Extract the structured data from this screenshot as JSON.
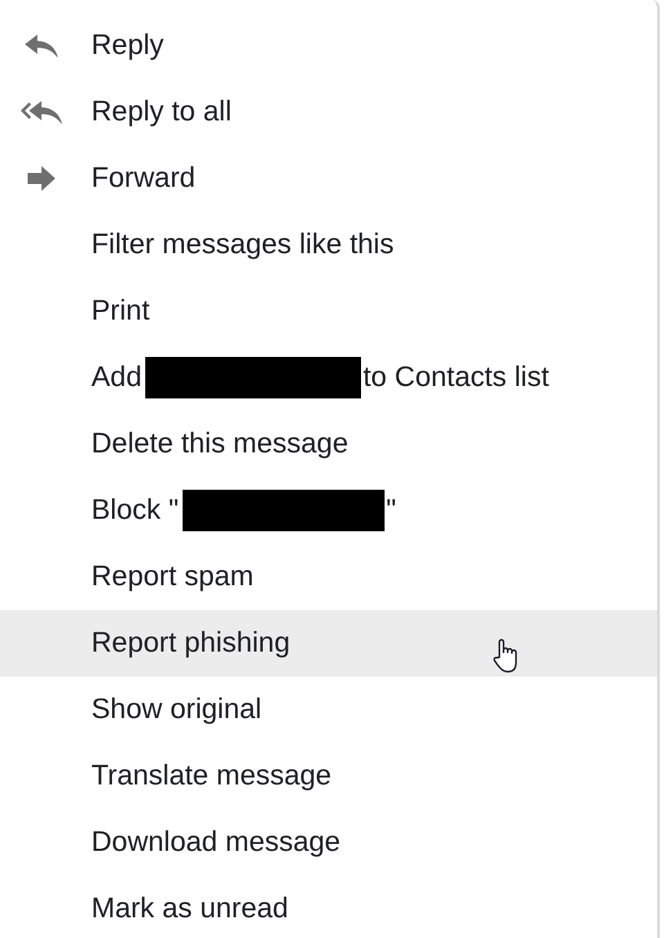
{
  "menu": {
    "items": [
      {
        "kind": "reply",
        "label": "Reply",
        "hovered": false
      },
      {
        "kind": "reply-all",
        "label": "Reply to all",
        "hovered": false
      },
      {
        "kind": "forward",
        "label": "Forward",
        "hovered": false
      },
      {
        "label": "Filter messages like this",
        "hovered": false
      },
      {
        "label": "Print",
        "hovered": false
      },
      {
        "label": "Add",
        "redacted": true,
        "label_after": "to Contacts list",
        "hovered": false
      },
      {
        "label": "Delete this message",
        "hovered": false
      },
      {
        "label": "Block \"",
        "redacted": true,
        "label_after": "\"",
        "hovered": false
      },
      {
        "label": "Report spam",
        "hovered": false
      },
      {
        "label": "Report phishing",
        "hovered": true
      },
      {
        "label": "Show original",
        "hovered": false
      },
      {
        "label": "Translate message",
        "hovered": false
      },
      {
        "label": "Download message",
        "hovered": false
      },
      {
        "label": "Mark as unread",
        "hovered": false
      }
    ]
  }
}
